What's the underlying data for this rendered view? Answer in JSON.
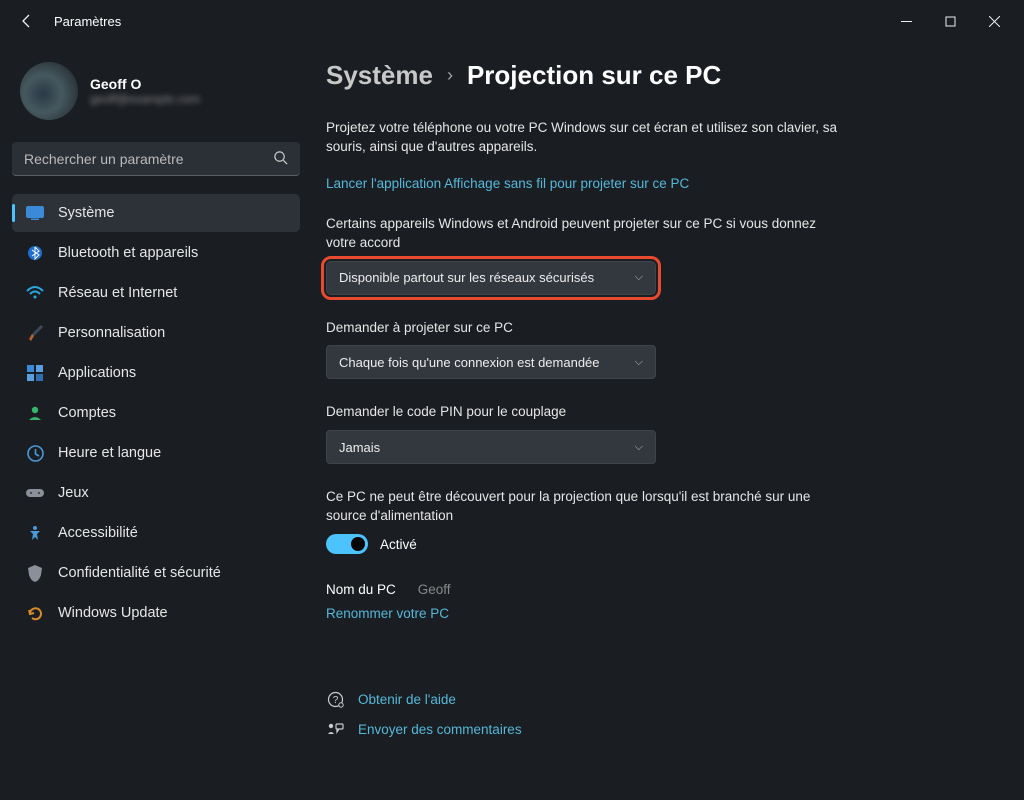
{
  "titlebar": {
    "title": "Paramètres"
  },
  "profile": {
    "name": "Geoff O",
    "email": "geoff@example.com"
  },
  "search": {
    "placeholder": "Rechercher un paramètre"
  },
  "nav": [
    {
      "id": "system",
      "label": "Système"
    },
    {
      "id": "bluetooth",
      "label": "Bluetooth et appareils"
    },
    {
      "id": "network",
      "label": "Réseau et Internet"
    },
    {
      "id": "personalize",
      "label": "Personnalisation"
    },
    {
      "id": "apps",
      "label": "Applications"
    },
    {
      "id": "accounts",
      "label": "Comptes"
    },
    {
      "id": "time",
      "label": "Heure et langue"
    },
    {
      "id": "gaming",
      "label": "Jeux"
    },
    {
      "id": "accessibility",
      "label": "Accessibilité"
    },
    {
      "id": "privacy",
      "label": "Confidentialité et sécurité"
    },
    {
      "id": "update",
      "label": "Windows Update"
    }
  ],
  "breadcrumb": {
    "level1": "Système",
    "level2": "Projection sur ce PC"
  },
  "main": {
    "description": "Projetez votre téléphone ou votre PC Windows sur cet écran et utilisez son clavier, sa souris, ainsi que d'autres appareils.",
    "launchLink": "Lancer l'application Affichage sans fil pour projeter sur ce PC",
    "setting1": {
      "label": "Certains appareils Windows et Android peuvent projeter sur ce PC si vous donnez votre accord",
      "value": "Disponible partout sur les réseaux sécurisés"
    },
    "setting2": {
      "label": "Demander à projeter sur ce PC",
      "value": "Chaque fois qu'une connexion est demandée"
    },
    "setting3": {
      "label": "Demander le code PIN pour le couplage",
      "value": "Jamais"
    },
    "setting4": {
      "label": "Ce PC ne peut être découvert pour la projection que lorsqu'il est branché sur une source d'alimentation",
      "toggleText": "Activé"
    },
    "pcName": {
      "label": "Nom du PC",
      "value": "Geoff",
      "renameLink": "Renommer votre PC"
    },
    "help": "Obtenir de l'aide",
    "feedback": "Envoyer des commentaires"
  }
}
